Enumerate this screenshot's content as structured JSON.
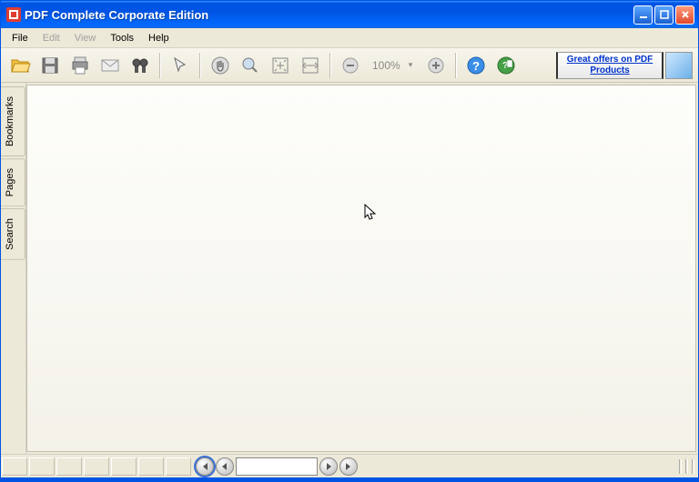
{
  "window": {
    "title": "PDF Complete Corporate Edition"
  },
  "menu": {
    "file": "File",
    "edit": "Edit",
    "view": "View",
    "tools": "Tools",
    "help": "Help"
  },
  "toolbar": {
    "zoom_level": "100%",
    "promo_text": "Great offers on PDF Products"
  },
  "sidebar": {
    "bookmarks": "Bookmarks",
    "pages": "Pages",
    "search": "Search"
  },
  "icons": {
    "open": "open-folder-icon",
    "save": "save-icon",
    "print": "print-icon",
    "mail": "mail-icon",
    "find": "binoculars-icon",
    "select": "pointer-icon",
    "hand": "hand-icon",
    "zoom": "magnifier-icon",
    "fitpage": "fit-page-icon",
    "fitwidth": "fit-width-icon",
    "zoomout": "zoom-out-icon",
    "zoomin": "zoom-in-icon",
    "help": "help-icon",
    "about": "about-icon"
  },
  "colors": {
    "titlebar": "#0054e3",
    "chrome": "#ece9d8",
    "link": "#0033cc"
  }
}
